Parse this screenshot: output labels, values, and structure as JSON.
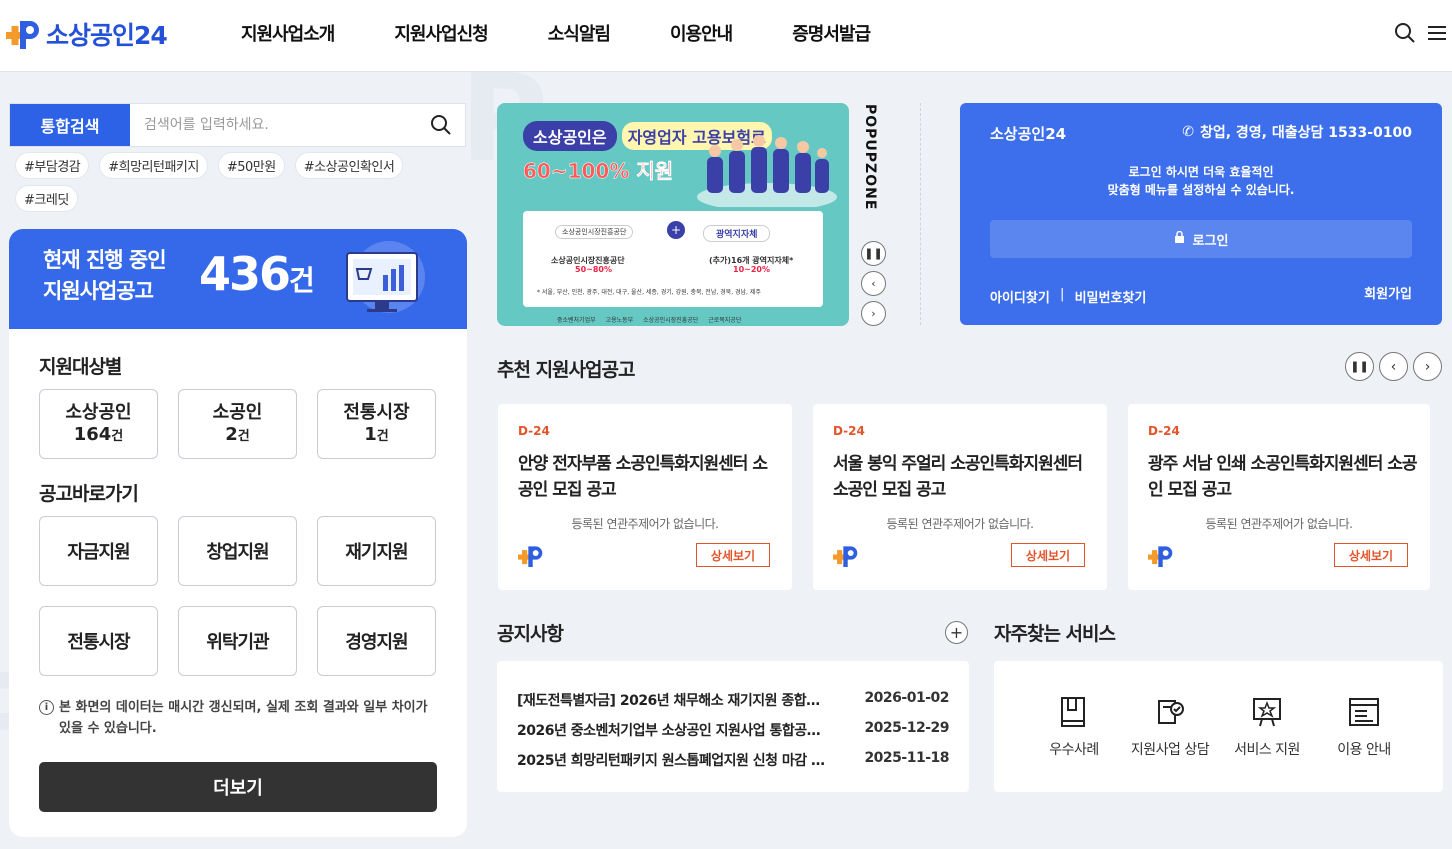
{
  "header": {
    "logo_text": "소상공인24",
    "nav": [
      "지원사업소개",
      "지원사업신청",
      "소식알림",
      "이용안내",
      "증명서발급"
    ]
  },
  "search": {
    "label": "통합검색",
    "placeholder": "검색어를 입력하세요.",
    "tags": [
      "#부담경감",
      "#희망리턴패키지",
      "#50만원",
      "#소상공인확인서",
      "#크레딧"
    ]
  },
  "summary": {
    "label_line1": "현재 진행 중인",
    "label_line2": "지원사업공고",
    "count": "436",
    "unit": "건"
  },
  "targets": {
    "title": "지원대상별",
    "items": [
      {
        "name": "소상공인",
        "count": "164",
        "unit": "건"
      },
      {
        "name": "소공인",
        "count": "2",
        "unit": "건"
      },
      {
        "name": "전통시장",
        "count": "1",
        "unit": "건"
      }
    ]
  },
  "goto": {
    "title": "공고바로가기",
    "items": [
      "자금지원",
      "창업지원",
      "재기지원",
      "전통시장",
      "위탁기관",
      "경영지원"
    ]
  },
  "notice_text": "본 화면의 데이터는 매시간 갱신되며, 실제 조회 결과와 일부 차이가 있을 수 있습니다.",
  "more_label": "더보기",
  "popup": {
    "label": "POPUPZONE",
    "banner_title1": "소상공인은",
    "banner_title2": "자영업자 고용보험료",
    "banner_title3": "60~100% 지원",
    "org1": "소상공인시장진흥공단",
    "org2": "광역지자체",
    "rate1": "소상공인시장진흥공단",
    "rate1_val": "50~80%",
    "rate2": "(추가)16개 광역지자체*",
    "rate2_val": "10~20%",
    "regions": "* 서울, 부산, 인천, 광주, 대전, 대구, 울산, 세종, 경기, 강원, 충북, 전남, 경북, 경남, 제주",
    "footer_orgs": [
      "중소벤처기업부",
      "고용노동부",
      "소상공인시장진흥공단",
      "근로복지공단"
    ]
  },
  "login": {
    "title": "소상공인24",
    "phone": "창업, 경영, 대출상담 1533-0100",
    "msg1": "로그인 하시면 더욱 효율적인",
    "msg2": "맞춤형 메뉴를 설정하실 수 있습니다.",
    "button": "로그인",
    "find_id": "아이디찾기",
    "find_pw": "비밀번호찾기",
    "join": "회원가입"
  },
  "recommend": {
    "title": "추천 지원사업공고",
    "cards": [
      {
        "dday": "D-24",
        "title": "안양 전자부품 소공인특화지원센터 소공인 모집 공고",
        "sub": "등록된 연관주제어가 없습니다.",
        "button": "상세보기"
      },
      {
        "dday": "D-24",
        "title": "서울 봉익 주얼리 소공인특화지원센터 소공인 모집 공고",
        "sub": "등록된 연관주제어가 없습니다.",
        "button": "상세보기"
      },
      {
        "dday": "D-24",
        "title": "광주 서남 인쇄 소공인특화지원센터 소공인 모집 공고",
        "sub": "등록된 연관주제어가 없습니다.",
        "button": "상세보기"
      }
    ]
  },
  "notices": {
    "title": "공지사항",
    "items": [
      {
        "title": "[재도전특별자금] 2026년 채무해소 재기지원 종합…",
        "date": "2026-01-02"
      },
      {
        "title": "2026년 중소벤처기업부 소상공인 지원사업 통합공…",
        "date": "2025-12-29"
      },
      {
        "title": "2025년 희망리턴패키지 원스톱폐업지원 신청 마감 …",
        "date": "2025-11-18"
      }
    ]
  },
  "services": {
    "title": "자주찾는 서비스",
    "items": [
      "우수사례",
      "지원사업 상담",
      "서비스 지원",
      "이용 안내"
    ]
  }
}
